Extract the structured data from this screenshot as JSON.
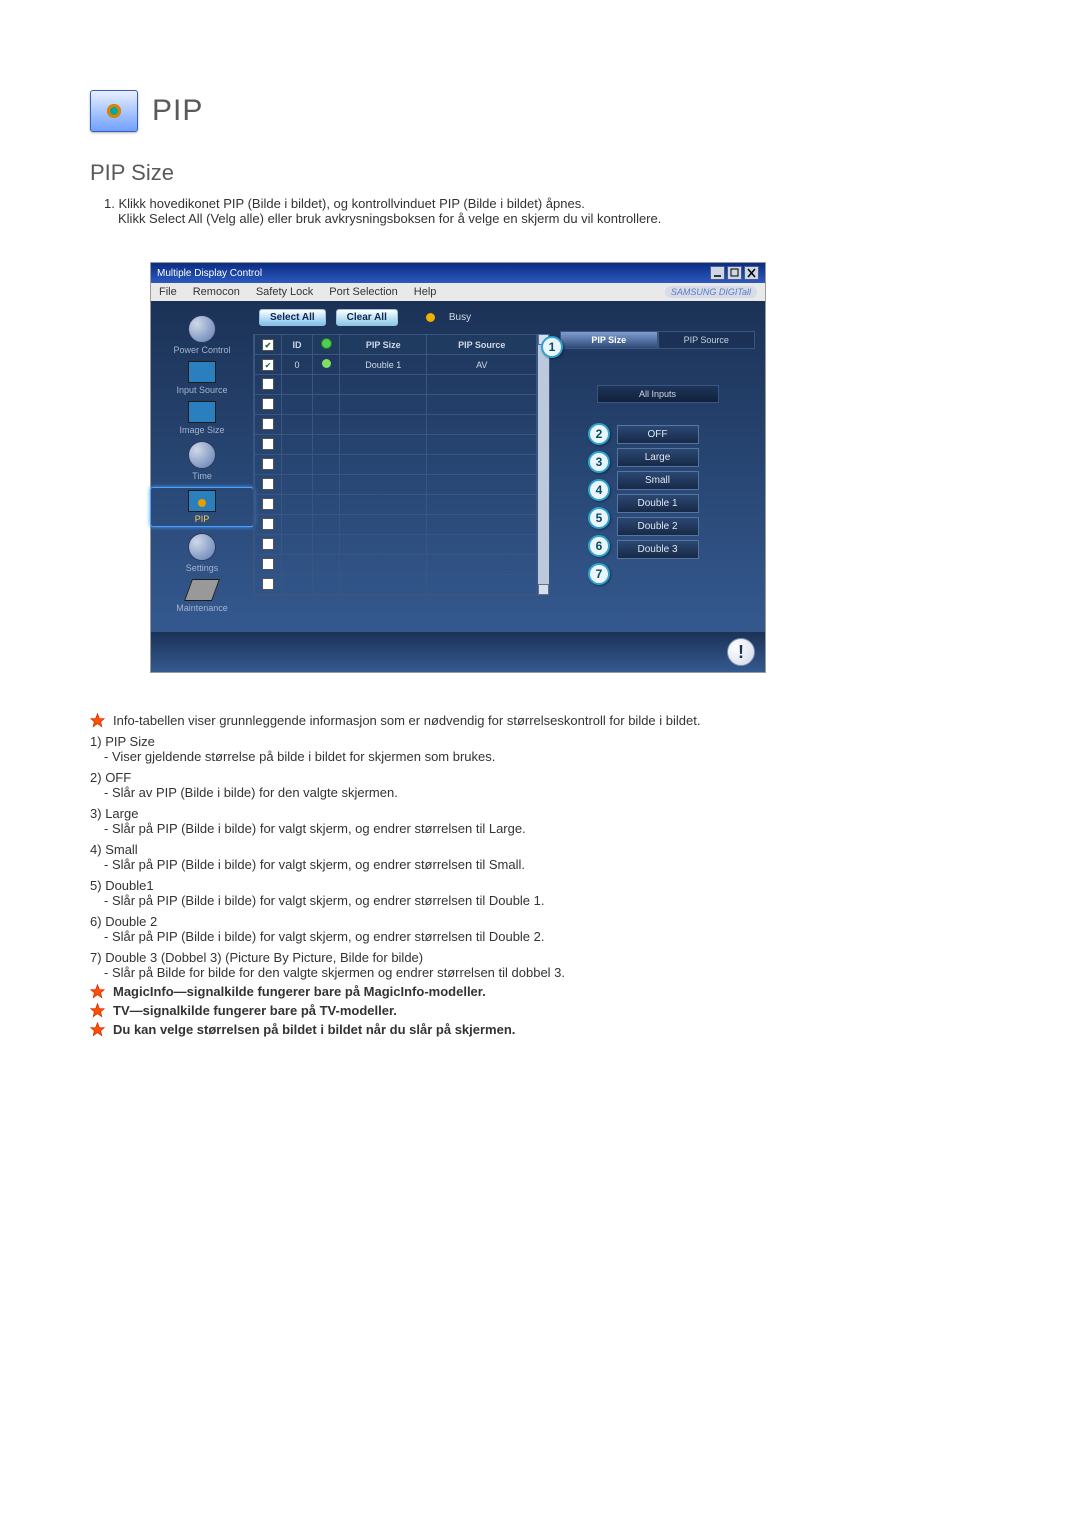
{
  "title": "PIP",
  "subtitle": "PIP Size",
  "intro_num": "1.",
  "intro_line1": "Klikk hovedikonet PIP (Bilde i bildet), og kontrollvinduet PIP (Bilde i bildet) åpnes.",
  "intro_line2": "Klikk Select All (Velg alle) eller bruk avkrysningsboksen for å velge en skjerm du vil kontrollere.",
  "app": {
    "wintitle": "Multiple Display Control",
    "menu": {
      "file": "File",
      "remocon": "Remocon",
      "safety": "Safety Lock",
      "port": "Port Selection",
      "help": "Help"
    },
    "brand": "SAMSUNG DIGITall",
    "sidebar": {
      "power": "Power Control",
      "input": "Input Source",
      "image": "Image Size",
      "time": "Time",
      "pip": "PIP",
      "settings": "Settings",
      "maint": "Maintenance"
    },
    "actions": {
      "select": "Select All",
      "clear": "Clear All",
      "busy": "Busy"
    },
    "thead": {
      "id": "ID",
      "pipsize": "PIP Size",
      "pipsource": "PIP Source"
    },
    "row": {
      "id": "0",
      "pipsize": "Double 1",
      "pipsource": "AV"
    },
    "tabs": {
      "size": "PIP Size",
      "source": "PIP Source"
    },
    "allinputs": "All Inputs",
    "opts": {
      "off": "OFF",
      "large": "Large",
      "small": "Small",
      "d1": "Double 1",
      "d2": "Double 2",
      "d3": "Double 3"
    },
    "call": {
      "c1": "1",
      "c2": "2",
      "c3": "3",
      "c4": "4",
      "c5": "5",
      "c6": "6",
      "c7": "7"
    }
  },
  "star1": "Info-tabellen viser grunnleggende informasjon som er nødvendig for størrelseskontroll for bilde i bildet.",
  "items": [
    {
      "n": "1)",
      "h": "PIP Size",
      "d": "- Viser gjeldende størrelse på bilde i bildet for skjermen som brukes."
    },
    {
      "n": "2)",
      "h": "OFF",
      "d": "- Slår av PIP (Bilde i bilde) for den valgte skjermen."
    },
    {
      "n": "3)",
      "h": "Large",
      "d": "- Slår på PIP (Bilde i bilde) for valgt skjerm, og endrer størrelsen til Large."
    },
    {
      "n": "4)",
      "h": "Small",
      "d": "- Slår på PIP (Bilde i bilde) for valgt skjerm, og endrer størrelsen til Small."
    },
    {
      "n": "5)",
      "h": "Double1",
      "d": "- Slår på PIP (Bilde i bilde) for valgt skjerm, og endrer størrelsen til Double 1."
    },
    {
      "n": "6)",
      "h": "Double 2",
      "d": "- Slår på PIP (Bilde i bilde) for valgt skjerm, og endrer størrelsen til Double 2."
    },
    {
      "n": "7)",
      "h": "Double 3 (Dobbel 3) (Picture By Picture, Bilde for bilde)",
      "d": "- Slår på Bilde for bilde for den valgte skjermen og endrer størrelsen til dobbel 3."
    }
  ],
  "star2": "MagicInfo—signalkilde fungerer bare på MagicInfo-modeller.",
  "star3": "TV—signalkilde fungerer bare på TV-modeller.",
  "star4": "Du kan velge størrelsen på bildet i bildet når du slår på skjermen."
}
